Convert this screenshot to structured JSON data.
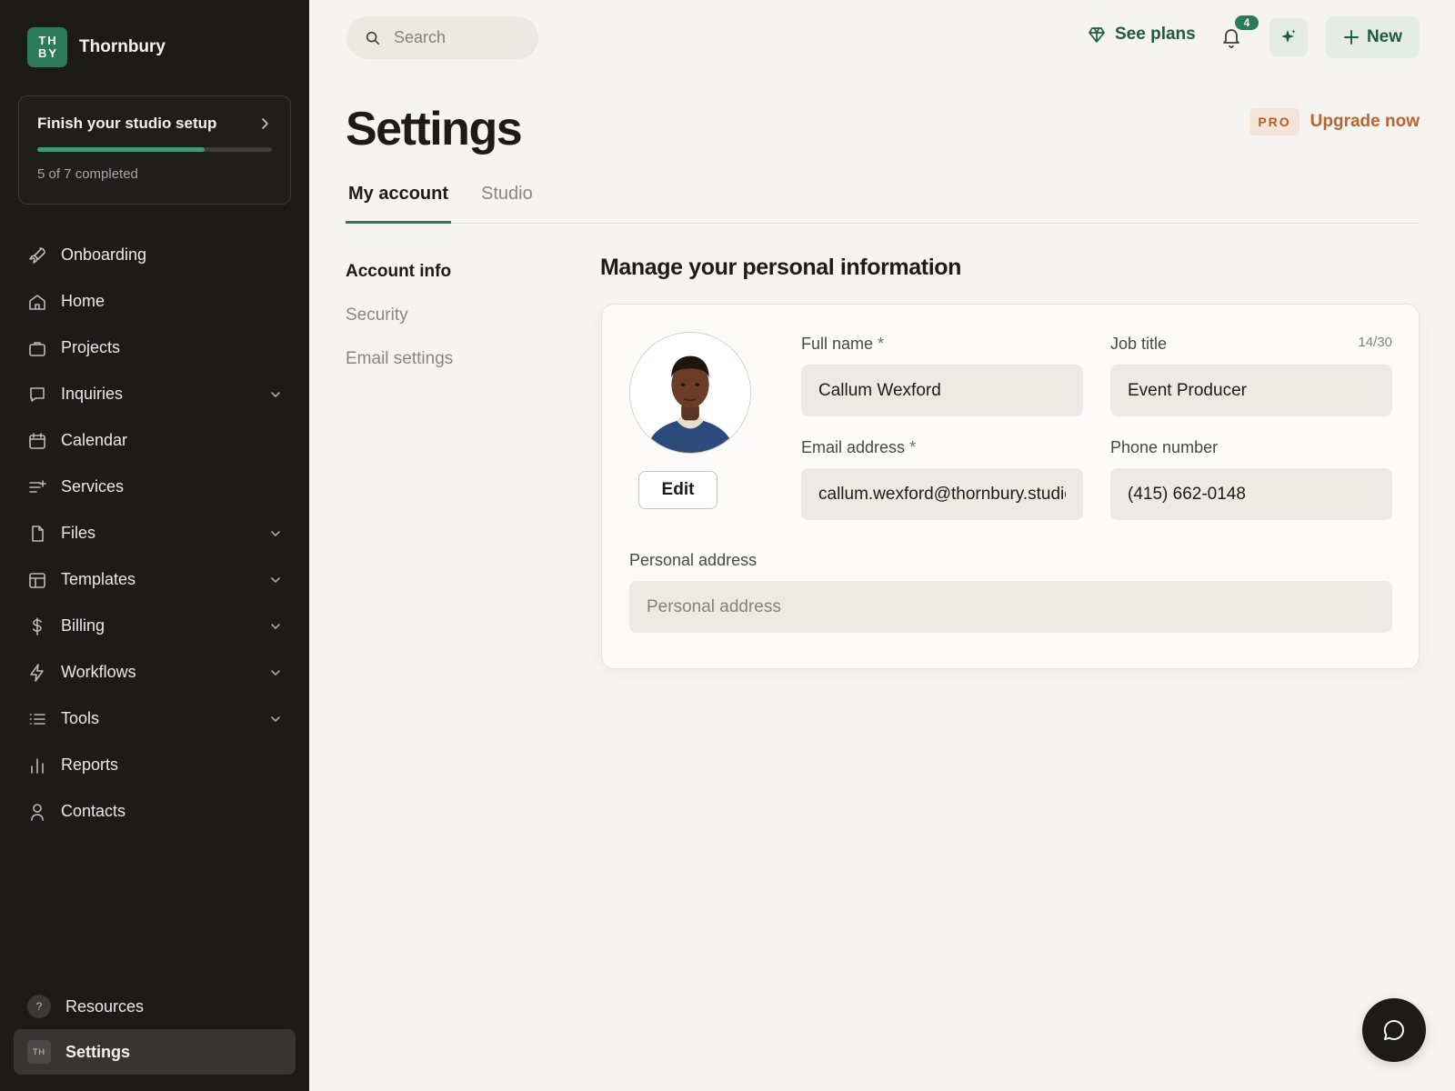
{
  "brand": {
    "logo_line1": "TH",
    "logo_line2": "BY",
    "name": "Thornbury"
  },
  "setup": {
    "title": "Finish your studio setup",
    "progress": "5 of 7 completed",
    "completed": 5,
    "total": 7
  },
  "nav": {
    "items": [
      {
        "label": "Onboarding",
        "icon": "rocket-icon",
        "expandable": false
      },
      {
        "label": "Home",
        "icon": "home-icon",
        "expandable": false
      },
      {
        "label": "Projects",
        "icon": "briefcase-icon",
        "expandable": false
      },
      {
        "label": "Inquiries",
        "icon": "chat-bubble-icon",
        "expandable": true
      },
      {
        "label": "Calendar",
        "icon": "calendar-icon",
        "expandable": false
      },
      {
        "label": "Services",
        "icon": "list-plus-icon",
        "expandable": false
      },
      {
        "label": "Files",
        "icon": "file-icon",
        "expandable": true
      },
      {
        "label": "Templates",
        "icon": "layout-icon",
        "expandable": true
      },
      {
        "label": "Billing",
        "icon": "dollar-icon",
        "expandable": true
      },
      {
        "label": "Workflows",
        "icon": "bolt-icon",
        "expandable": true
      },
      {
        "label": "Tools",
        "icon": "list-icon",
        "expandable": true
      },
      {
        "label": "Reports",
        "icon": "bar-chart-icon",
        "expandable": false
      },
      {
        "label": "Contacts",
        "icon": "user-icon",
        "expandable": false
      }
    ],
    "resources": "Resources",
    "settings": "Settings",
    "settings_badge": "TH"
  },
  "topbar": {
    "search_placeholder": "Search",
    "see_plans": "See plans",
    "notifications_count": "4",
    "new_label": "New"
  },
  "header": {
    "title": "Settings",
    "pro_badge": "PRO",
    "upgrade": "Upgrade now"
  },
  "tabs": [
    {
      "label": "My account",
      "active": true
    },
    {
      "label": "Studio",
      "active": false
    }
  ],
  "subnav": [
    {
      "label": "Account info",
      "active": true
    },
    {
      "label": "Security",
      "active": false
    },
    {
      "label": "Email settings",
      "active": false
    }
  ],
  "section": {
    "title": "Manage your personal information"
  },
  "profile": {
    "edit_label": "Edit",
    "full_name": {
      "label": "Full name",
      "required": "*",
      "value": "Callum Wexford"
    },
    "job_title": {
      "label": "Job title",
      "counter": "14/30",
      "value": "Event Producer"
    },
    "email": {
      "label": "Email address",
      "required": "*",
      "value": "callum.wexford@thornbury.studio"
    },
    "phone": {
      "label": "Phone number",
      "value": "(415) 662-0148"
    },
    "address": {
      "label": "Personal address",
      "placeholder": "Personal address",
      "value": ""
    }
  },
  "colors": {
    "sidebar_bg": "#1c1b1a",
    "accent": "#2b7a5a",
    "accent_dark": "#1f5a44",
    "upgrade": "#b8652f",
    "page_bg": "#f5f4f0"
  }
}
